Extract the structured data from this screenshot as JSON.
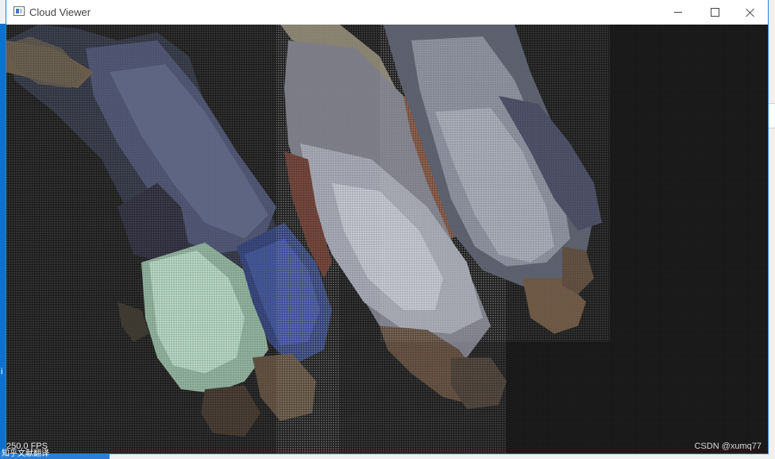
{
  "window": {
    "title": "Cloud Viewer",
    "controls": [
      "minimize",
      "maximize",
      "close"
    ],
    "icon": "app-window-icon"
  },
  "viewport": {
    "fps": "250.0 FPS",
    "watermark": "CSDN @xumq77",
    "background": "#1c1c1c"
  },
  "desktop": {
    "ime_text": "知乎文献翻译",
    "side_char": "i",
    "accent": "#0f72c9"
  }
}
